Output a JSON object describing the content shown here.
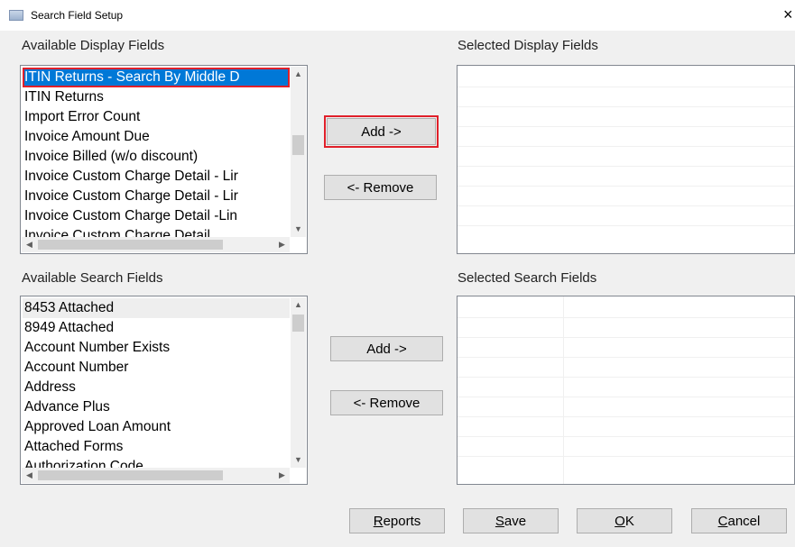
{
  "window": {
    "title": "Search Field Setup",
    "close_glyph": "×"
  },
  "display": {
    "available_label": "Available Display Fields",
    "selected_label": "Selected Display Fields",
    "items": [
      "ITIN Returns - Search By Middle D",
      "ITIN Returns",
      "Import Error Count",
      "Invoice Amount Due",
      "Invoice Billed (w/o discount)",
      "Invoice Custom Charge Detail - Lir",
      "Invoice Custom Charge Detail - Lir",
      "Invoice Custom Charge Detail -Lin",
      "Invoice Custom Charge Detail"
    ],
    "add_label": "Add ->",
    "remove_label": "<- Remove"
  },
  "search": {
    "available_label": "Available Search Fields",
    "selected_label": "Selected Search Fields",
    "items": [
      "8453 Attached",
      "8949 Attached",
      "Account Number Exists",
      "Account Number",
      "Address",
      "Advance Plus",
      "Approved Loan Amount",
      "Attached Forms",
      "Authorization Code"
    ],
    "add_label": "Add ->",
    "remove_label": "<- Remove"
  },
  "footer": {
    "reports": {
      "mnemonic": "R",
      "rest": "eports"
    },
    "save": {
      "mnemonic": "S",
      "rest": "ave"
    },
    "ok": {
      "mnemonic": "O",
      "rest": "K"
    },
    "cancel": {
      "mnemonic": "C",
      "rest": "ancel"
    }
  },
  "colors": {
    "selection": "#0078d7",
    "highlight_border": "#e0202a"
  }
}
